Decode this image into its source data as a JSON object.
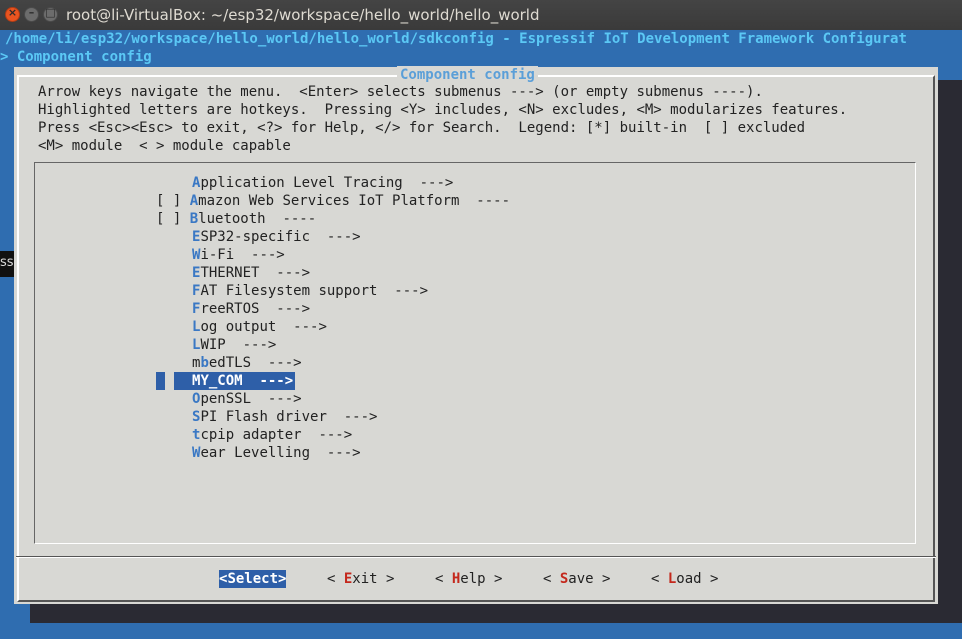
{
  "window": {
    "title": "root@li-VirtualBox: ~/esp32/workspace/hello_world/hello_world"
  },
  "terminal": {
    "header_line": "/home/li/esp32/workspace/hello_world/hello_world/sdkconfig - Espressif IoT Development Framework Configurat",
    "breadcrumb": "> Component config",
    "tooltip": "ss"
  },
  "dialog": {
    "title": "Component config",
    "help": [
      "Arrow keys navigate the menu.  <Enter> selects submenus ---> (or empty submenus ----).",
      "Highlighted letters are hotkeys.  Pressing <Y> includes, <N> excludes, <M> modularizes features.",
      "Press <Esc><Esc> to exit, <?> for Help, </> for Search.  Legend: [*] built-in  [ ] excluded",
      "<M> module  < > module capable"
    ],
    "menu_items": [
      {
        "prefix": "",
        "hotkey": "A",
        "rest": "pplication Level Tracing  --->",
        "selected": false
      },
      {
        "prefix": "[ ] ",
        "hotkey": "A",
        "rest": "mazon Web Services IoT Platform  ----",
        "selected": false
      },
      {
        "prefix": "[ ] ",
        "hotkey": "B",
        "rest": "luetooth  ----",
        "selected": false
      },
      {
        "prefix": "",
        "hotkey": "E",
        "rest": "SP32-specific  --->",
        "selected": false
      },
      {
        "prefix": "",
        "hotkey": "W",
        "rest": "i-Fi  --->",
        "selected": false
      },
      {
        "prefix": "",
        "hotkey": "E",
        "rest": "THERNET  --->",
        "selected": false
      },
      {
        "prefix": "",
        "hotkey": "F",
        "rest": "AT Filesystem support  --->",
        "selected": false
      },
      {
        "prefix": "",
        "hotkey": "F",
        "rest": "reeRTOS  --->",
        "selected": false
      },
      {
        "prefix": "",
        "hotkey": "L",
        "rest": "og output  --->",
        "selected": false
      },
      {
        "prefix": "",
        "hotkey": "L",
        "rest": "WIP  --->",
        "selected": false
      },
      {
        "prefix": "m",
        "hotkey": "b",
        "rest": "edTLS  --->",
        "selected": false
      },
      {
        "prefix": "",
        "hotkey": "M",
        "rest": "Y_COM  --->",
        "selected": true
      },
      {
        "prefix": "",
        "hotkey": "O",
        "rest": "penSSL  --->",
        "selected": false
      },
      {
        "prefix": "",
        "hotkey": "S",
        "rest": "PI Flash driver  --->",
        "selected": false
      },
      {
        "prefix": "",
        "hotkey": "t",
        "rest": "cpip adapter  --->",
        "selected": false
      },
      {
        "prefix": "",
        "hotkey": "W",
        "rest": "ear Levelling  --->",
        "selected": false
      }
    ],
    "buttons": [
      {
        "pre": "<",
        "hotkey": "S",
        "post": "elect>",
        "active": true
      },
      {
        "pre": "< ",
        "hotkey": "E",
        "post": "xit >",
        "active": false
      },
      {
        "pre": "< ",
        "hotkey": "H",
        "post": "elp >",
        "active": false
      },
      {
        "pre": "< ",
        "hotkey": "S",
        "post": "ave >",
        "active": false
      },
      {
        "pre": "< ",
        "hotkey": "L",
        "post": "oad >",
        "active": false
      }
    ]
  }
}
